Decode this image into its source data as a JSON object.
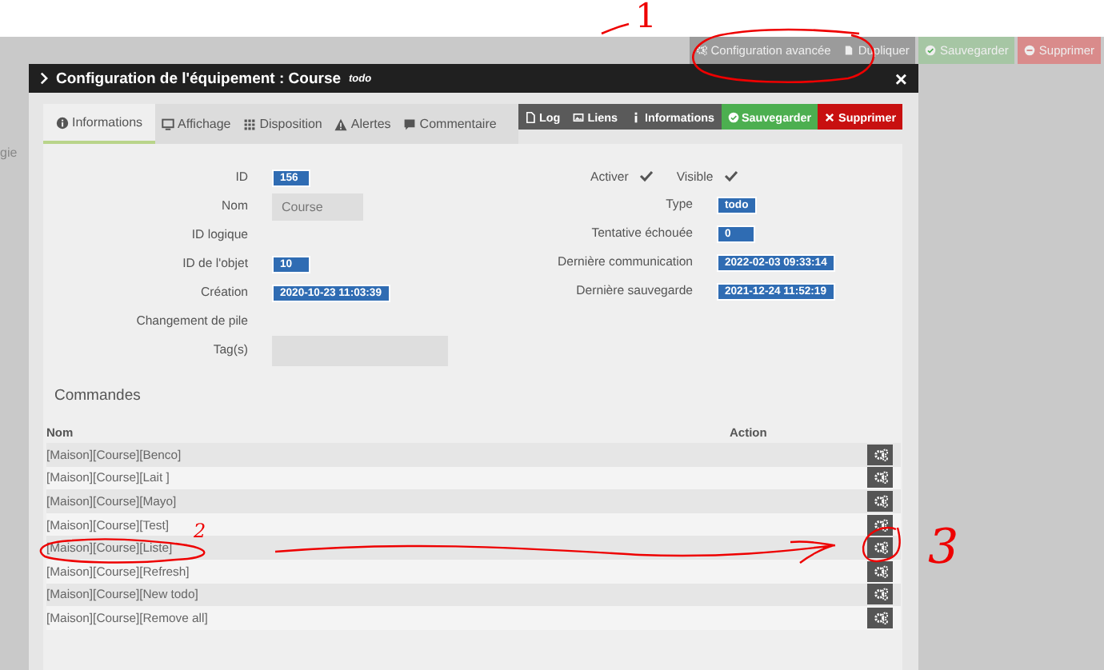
{
  "page_actions": [
    {
      "label": "Configuration avancée",
      "kind": "config"
    },
    {
      "label": "Dupliquer",
      "kind": "duplicate"
    },
    {
      "label": "Sauvegarder",
      "kind": "save"
    },
    {
      "label": "Supprimer",
      "kind": "delete"
    }
  ],
  "background_text": "gie",
  "modal": {
    "title": "Configuration de l'équipement : Course",
    "subtitle": "todo",
    "close": "×"
  },
  "tabs": [
    {
      "label": "Informations",
      "kind": "info",
      "selected": true
    },
    {
      "label": "Affichage",
      "kind": "display",
      "selected": false
    },
    {
      "label": "Disposition",
      "kind": "layout",
      "selected": false
    },
    {
      "label": "Alertes",
      "kind": "alerts",
      "selected": false
    },
    {
      "label": "Commentaire",
      "kind": "comment",
      "selected": false
    }
  ],
  "actions": [
    {
      "label": "Log",
      "kind": "log"
    },
    {
      "label": "Liens",
      "kind": "links"
    },
    {
      "label": "Informations",
      "kind": "info"
    },
    {
      "label": "Sauvegarder",
      "kind": "save"
    },
    {
      "label": "Supprimer",
      "kind": "delete"
    }
  ],
  "fields_left": [
    {
      "label": "ID",
      "kind": "badge",
      "value": "156"
    },
    {
      "label": "Nom",
      "kind": "input",
      "value": "Course"
    },
    {
      "label": "ID logique",
      "kind": "empty"
    },
    {
      "label": "ID de l'objet",
      "kind": "badge",
      "value": "10"
    },
    {
      "label": "Création",
      "kind": "badge",
      "value": "2020-10-23 11:03:39"
    },
    {
      "label": "Changement de pile",
      "kind": "empty"
    },
    {
      "label": "Tag(s)",
      "kind": "input"
    }
  ],
  "toggles": [
    {
      "label": "Activer",
      "checked": true
    },
    {
      "label": "Visible",
      "checked": true
    }
  ],
  "fields_right": [
    {
      "label": "Type",
      "kind": "badge",
      "value": "todo"
    },
    {
      "label": "Tentative échouée",
      "kind": "badge",
      "value": "0"
    },
    {
      "label": "Dernière communication",
      "kind": "badge",
      "value": "2022-02-03 09:33:14"
    },
    {
      "label": "Dernière sauvegarde",
      "kind": "badge",
      "value": "2021-12-24 11:52:19"
    }
  ],
  "commands": {
    "title": "Commandes",
    "columns": [
      "Nom",
      "Action"
    ],
    "rows": [
      {
        "name": "[Maison][Course][Benco]"
      },
      {
        "name": "[Maison][Course][Lait ]"
      },
      {
        "name": "[Maison][Course][Mayo]"
      },
      {
        "name": "[Maison][Course][Test]"
      },
      {
        "name": "[Maison][Course][Liste]"
      },
      {
        "name": "[Maison][Course][Refresh]"
      },
      {
        "name": "[Maison][Course][New todo]"
      },
      {
        "name": "[Maison][Course][Remove all]"
      }
    ]
  },
  "annotations": [
    {
      "label": "1",
      "kind": "one"
    },
    {
      "label": "2",
      "kind": "two"
    },
    {
      "label": "3",
      "kind": "three"
    }
  ]
}
